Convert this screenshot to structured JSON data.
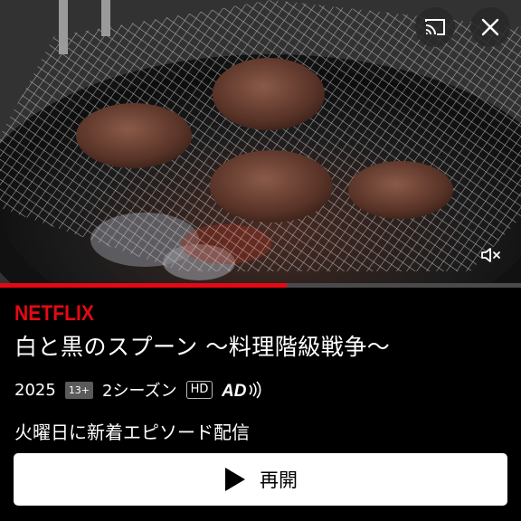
{
  "brand": {
    "logo_text": "NETFLIX",
    "color": "#e50914"
  },
  "show": {
    "title": "白と黒のスプーン 〜料理階級戦争〜",
    "year": "2025",
    "rating": "13+",
    "seasons": "2シーズン",
    "quality": "HD",
    "audio_description": "AD",
    "status": "火曜日に新着エピソード配信"
  },
  "actions": {
    "resume_label": "再開"
  },
  "playback": {
    "progress_fraction": 0.55,
    "muted": true
  },
  "icons": {
    "cast": "cast-icon",
    "close": "close-icon",
    "mute": "volume-muted-icon",
    "play": "play-icon",
    "audio_description": "audio-description-icon"
  },
  "colors": {
    "accent": "#e50914",
    "background": "#000000",
    "button": "#ffffff"
  }
}
